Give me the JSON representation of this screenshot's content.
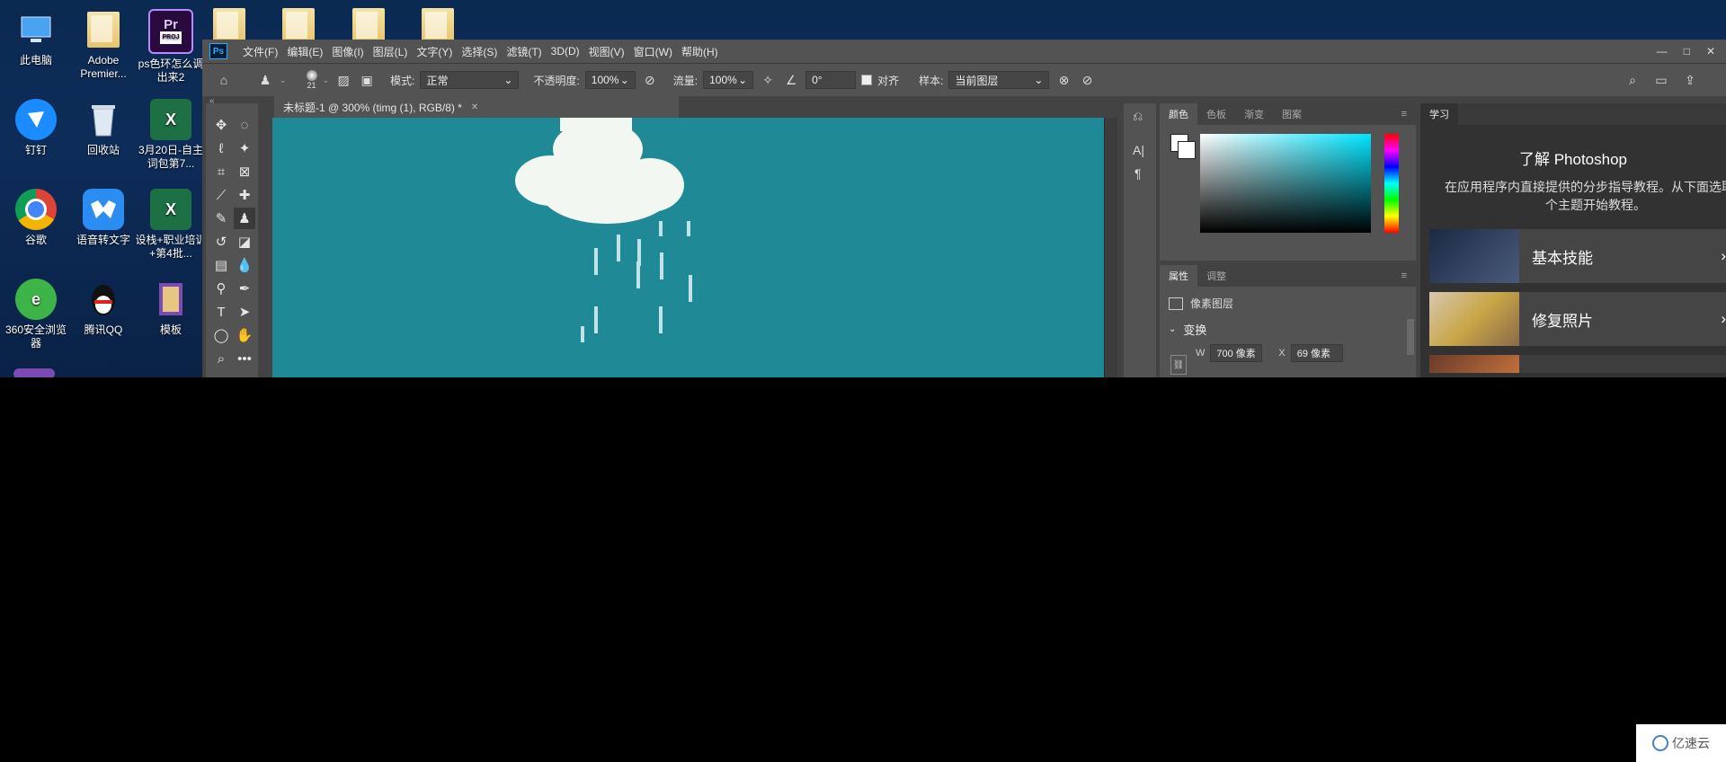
{
  "desktop": {
    "icons": [
      {
        "label": "此电脑",
        "name": "this-pc-icon"
      },
      {
        "label": "Adobe Premier...",
        "name": "adobe-premiere-folder-icon"
      },
      {
        "label": "ps色环怎么调出来2",
        "name": "premiere-project-icon"
      },
      {
        "label": "钉钉",
        "name": "dingtalk-icon"
      },
      {
        "label": "回收站",
        "name": "recycle-bin-icon"
      },
      {
        "label": "3月20日-自主词包第7...",
        "name": "excel-file-icon"
      },
      {
        "label": "谷歌",
        "name": "chrome-icon"
      },
      {
        "label": "语音转文字",
        "name": "speech-to-text-icon"
      },
      {
        "label": "设栈+职业培训+第4批...",
        "name": "excel-file-icon-2"
      },
      {
        "label": "360安全浏览器",
        "name": "browser-360-icon"
      },
      {
        "label": "腾讯QQ",
        "name": "qq-icon"
      },
      {
        "label": "模板",
        "name": "template-icon"
      }
    ],
    "pr_badge": "Pr",
    "proj_badge": "PROJ"
  },
  "ps": {
    "logo": "Ps",
    "menu": [
      "文件(F)",
      "编辑(E)",
      "图像(I)",
      "图层(L)",
      "文字(Y)",
      "选择(S)",
      "滤镜(T)",
      "3D(D)",
      "视图(V)",
      "窗口(W)",
      "帮助(H)"
    ],
    "options": {
      "brush_size": "21",
      "mode_label": "模式:",
      "mode_value": "正常",
      "opacity_label": "不透明度:",
      "opacity_value": "100%",
      "flow_label": "流量:",
      "flow_value": "100%",
      "angle_value": "0°",
      "align_label": "对齐",
      "sample_label": "样本:",
      "sample_value": "当前图层"
    },
    "doc_tab": "未标题-1 @ 300% (timg (1), RGB/8) *",
    "color_tabs": [
      "颜色",
      "色板",
      "渐变",
      "图案"
    ],
    "props_tabs": [
      "属性",
      "调整"
    ],
    "props": {
      "layer_type": "像素图层",
      "transform_label": "变换",
      "w_label": "W",
      "w_value": "700 像素",
      "x_label": "X",
      "x_value": "69 像素"
    },
    "learn": {
      "tab": "学习",
      "title": "了解 Photoshop",
      "desc": "在应用程序内直接提供的分步指导教程。从下面选取一个主题开始教程。",
      "cards": [
        "基本技能",
        "修复照片"
      ]
    }
  },
  "watermark": "亿速云",
  "colors": {
    "canvas": "#1f8a96",
    "cloud": "#f2f7f2"
  }
}
